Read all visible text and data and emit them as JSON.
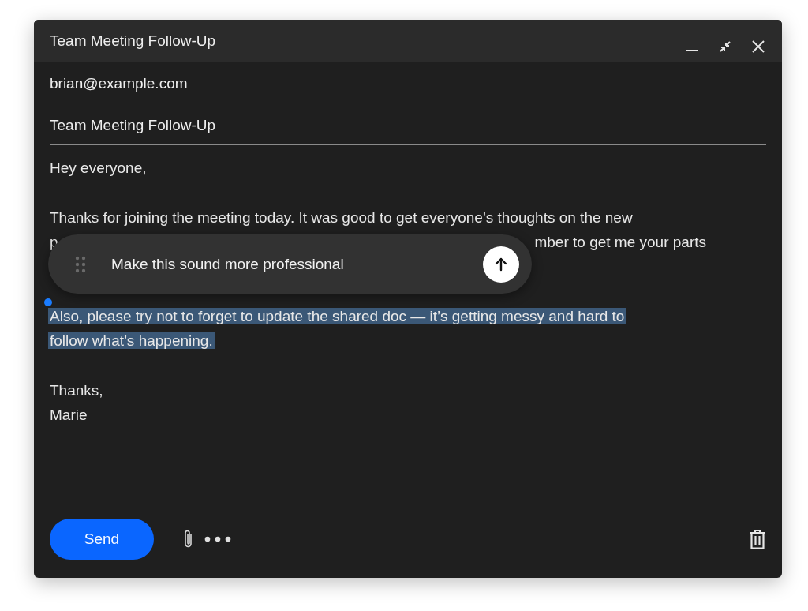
{
  "window": {
    "title": "Team Meeting Follow-Up"
  },
  "to": {
    "value": "brian@example.com"
  },
  "subject": {
    "value": "Team Meeting Follow-Up"
  },
  "body": {
    "greeting": "Hey everyone,",
    "paragraph_line_1": "Thanks for joining the meeting today. It was good to get everyone’s thoughts on the new",
    "paragraph_line_2_start": "p",
    "paragraph_line_2_end": "mber to get me your parts",
    "selected_text": [
      "Also, please try not to forget to update the shared doc — it’s getting messy and hard to",
      "follow what’s happening."
    ],
    "signoff": [
      "Thanks,",
      "Marie"
    ]
  },
  "prompt_popup": {
    "text": "Make this sound more professional"
  },
  "send_button": "Send"
}
